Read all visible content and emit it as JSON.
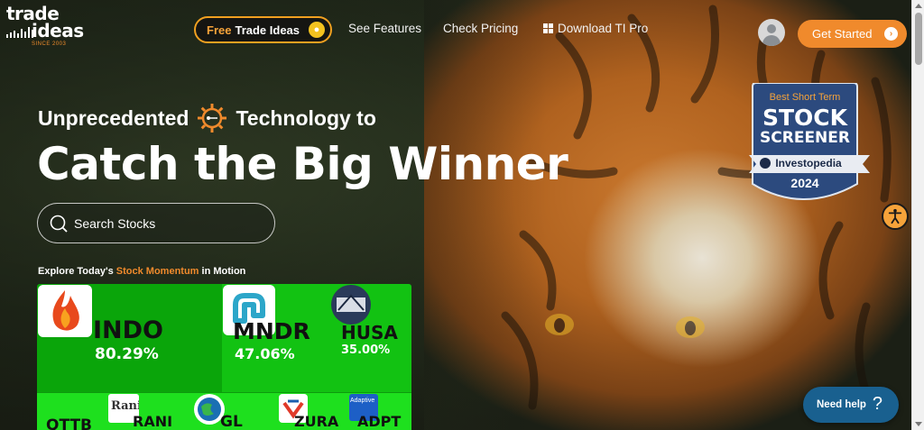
{
  "brand": {
    "logo_line1": "trade",
    "logo_line2": "ideas",
    "logo_since": "SINCE 2003"
  },
  "nav": {
    "free_prefix": "Free",
    "free_label": "Trade Ideas",
    "features": "See Features",
    "pricing": "Check Pricing",
    "download": "Download TI Pro",
    "get_started": "Get Started"
  },
  "hero": {
    "line1_a": "Unprecedented",
    "line1_b": "Technology to",
    "title": "Catch the Big Winner",
    "search_placeholder": "Search Stocks"
  },
  "explore": {
    "prefix": "Explore Today's",
    "highlight": "Stock Momentum",
    "suffix": "in Motion"
  },
  "heatmap": {
    "tiles": [
      {
        "symbol": "INDO",
        "change": "80.29%"
      },
      {
        "symbol": "MNDR",
        "change": "47.06%"
      },
      {
        "symbol": "HUSA",
        "change": "35.00%"
      },
      {
        "symbol": "QTTB",
        "change": ""
      },
      {
        "symbol": "RANI",
        "change": "",
        "logo_text": "Rani"
      },
      {
        "symbol": "GL",
        "change": ""
      },
      {
        "symbol": "ZURA",
        "change": ""
      },
      {
        "symbol": "ADPT",
        "change": "",
        "logo_text": "Adaptive"
      }
    ],
    "colors": {
      "strong": "#0aa50a",
      "mid": "#12c212",
      "bright": "#1ee01e"
    }
  },
  "badge": {
    "top": "Best Short Term",
    "line1": "STOCK",
    "line2": "SCREENER",
    "source": "Investopedia",
    "year": "2024"
  },
  "help": {
    "label": "Need help",
    "q": "?"
  },
  "colors": {
    "accent": "#f08a2c",
    "pill_border": "#f0a020",
    "help_bg": "#19608f",
    "badge_bg": "#2c4a7e"
  }
}
